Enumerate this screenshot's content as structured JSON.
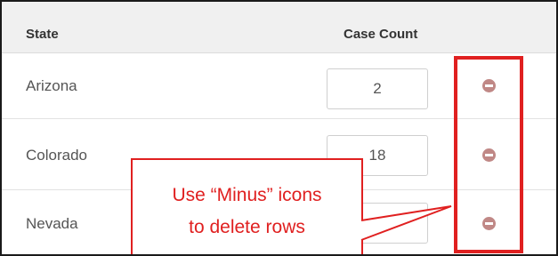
{
  "table": {
    "headers": {
      "state": "State",
      "count": "Case Count"
    },
    "rows": [
      {
        "state": "Arizona",
        "count": "2"
      },
      {
        "state": "Colorado",
        "count": "18"
      },
      {
        "state": "Nevada",
        "count": ""
      }
    ],
    "remove_icon": "minus-circle-icon"
  },
  "callout": {
    "line1": "Use “Minus” icons",
    "line2": "to delete rows"
  },
  "colors": {
    "annotation_red": "#e02020",
    "minus_icon": "#c08886",
    "header_bg": "#f0f0f0"
  }
}
